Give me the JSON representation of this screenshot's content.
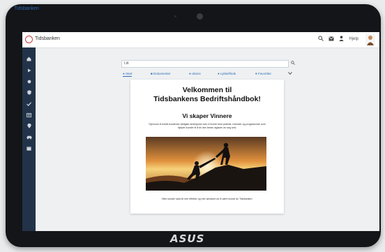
{
  "bezel": {
    "label": "Tidsbanken",
    "logo": "ASUS"
  },
  "topbar": {
    "brand": "Tidsbanken",
    "logo_icon": "tidsbanken-logo-icon",
    "icons": [
      "search-icon",
      "mail-icon",
      "user-icon"
    ],
    "user_label": "Hjelp"
  },
  "sidebar": {
    "items": [
      "home-icon",
      "play-icon",
      "circle-icon",
      "shield-icon",
      "check-icon",
      "table-icon",
      "pin-icon",
      "car-icon",
      "calendar-icon"
    ]
  },
  "search": {
    "value": "Litt"
  },
  "tabs": [
    "Start",
    "Dokumenter",
    "Ukens",
    "Lykkelfinde",
    "Favoritter"
  ],
  "card": {
    "welcome_line1": "Velkommen til",
    "welcome_line2": "Tidsbankens Bedriftshåndbok!",
    "subtitle": "Vi skaper Vinnere",
    "intro": "Gjennom å forstå kundenes viktigste ambisjoner kan vi levere best praksis, metoder og programvare som hjelper kunder til å bli den beste utgaven av seg selv.",
    "footer": "Våre kunder skal bli mer effektiv og mer lønnsom av å være kunde av Tidsbanken."
  },
  "colors": {
    "accent": "#2f6fb5",
    "sidebar": "#223349",
    "brand_red": "#d23c3c"
  }
}
